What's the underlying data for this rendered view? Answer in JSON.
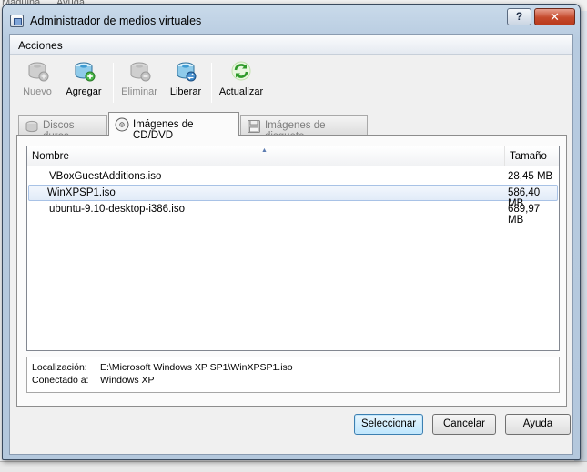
{
  "background": {
    "menu": [
      "Máquina",
      "Ayuda"
    ]
  },
  "window": {
    "title": "Administrador de medios virtuales",
    "help_glyph": "?",
    "close_glyph": "✕"
  },
  "menu": {
    "acciones": "Acciones"
  },
  "toolbar": {
    "nuevo": {
      "label": "Nuevo",
      "icon": "new-disk-icon",
      "enabled": false
    },
    "agregar": {
      "label": "Agregar",
      "icon": "add-disk-icon",
      "enabled": true
    },
    "eliminar": {
      "label": "Eliminar",
      "icon": "remove-disk-icon",
      "enabled": false
    },
    "liberar": {
      "label": "Liberar",
      "icon": "release-disk-icon",
      "enabled": true
    },
    "actualizar": {
      "label": "Actualizar",
      "icon": "refresh-icon",
      "enabled": true
    }
  },
  "tabs": [
    {
      "label": "Discos duros",
      "icon": "hard-disk-icon",
      "active": false
    },
    {
      "label": "Imágenes de CD/DVD",
      "icon": "cd-dvd-icon",
      "active": true
    },
    {
      "label": "Imágenes de disquete",
      "icon": "floppy-icon",
      "active": false
    }
  ],
  "list": {
    "columns": {
      "name": "Nombre",
      "size": "Tamaño"
    },
    "rows": [
      {
        "name": "VBoxGuestAdditions.iso",
        "size": "28,45 MB",
        "selected": false
      },
      {
        "name": "WinXPSP1.iso",
        "size": "586,40 MB",
        "selected": true
      },
      {
        "name": "ubuntu-9.10-desktop-i386.iso",
        "size": "689,97 MB",
        "selected": false
      }
    ]
  },
  "info": {
    "location_label": "Localización:",
    "location_value": "E:\\Microsoft Windows XP SP1\\WinXPSP1.iso",
    "attached_label": "Conectado a:",
    "attached_value": "Windows XP"
  },
  "buttons": {
    "select": "Seleccionar",
    "cancel": "Cancelar",
    "help": "Ayuda"
  },
  "colors": {
    "frame": "#b7cbe0",
    "selection": "#e1ebf8",
    "default_button": "#bee6fd"
  }
}
